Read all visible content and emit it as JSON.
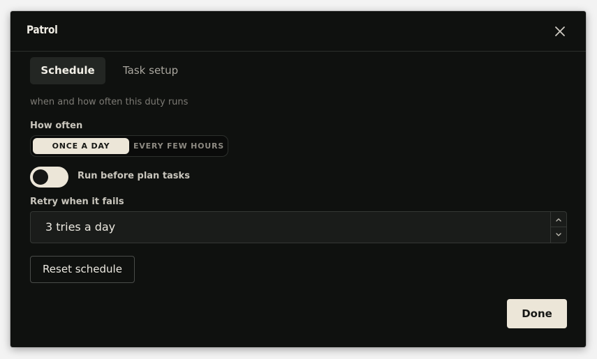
{
  "dialog": {
    "title": "Patrol",
    "close_icon": "close-icon"
  },
  "tabs": [
    {
      "label": "Schedule",
      "active": true
    },
    {
      "label": "Task setup",
      "active": false
    }
  ],
  "schedule": {
    "subtitle": "when and how often this duty runs",
    "how_often": {
      "label": "How often",
      "options": [
        "ONCE A DAY",
        "EVERY FEW HOURS"
      ],
      "selected": "ONCE A DAY"
    },
    "run_before": {
      "label": "Run before plan tasks",
      "enabled": false
    },
    "retry": {
      "label": "Retry when it fails",
      "value": "3 tries a day",
      "stepper_icons": [
        "chevron-up-icon",
        "chevron-down-icon"
      ]
    },
    "reset_label": "Reset schedule"
  },
  "footer": {
    "done_label": "Done"
  },
  "colors": {
    "dialog_bg": "#0f110f",
    "accent": "#ece6d8",
    "text": "#efece4",
    "muted": "#7d7b75"
  }
}
